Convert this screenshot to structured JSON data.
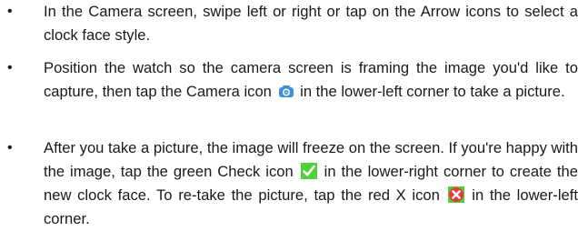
{
  "bullet_char": "•",
  "items": [
    {
      "text": "In the Camera screen, swipe left or right or tap on the Arrow icons to select a clock face style."
    },
    {
      "text_before": "Position the watch so the camera screen is framing the image you'd like to capture, then tap the Camera icon",
      "icon": "camera-icon",
      "text_after": "in the lower-left corner to take a picture."
    },
    {
      "text_before": "After you take a picture, the image will freeze on the screen. If you're happy with the image, tap the green Check icon",
      "icon_1": "check-icon",
      "text_middle": "in the lower-right corner to create the new clock face. To re-take the picture, tap the red X icon",
      "icon_2": "x-icon",
      "text_after": "in the lower-left corner."
    }
  ],
  "colors": {
    "text": "#1a1a1a",
    "camera_icon": "#3d8fd6",
    "check_icon_bg": "#4fd13a",
    "check_mark": "#ffffff",
    "x_icon_bg": "#e83a3a",
    "x_mark": "#ffffff"
  }
}
